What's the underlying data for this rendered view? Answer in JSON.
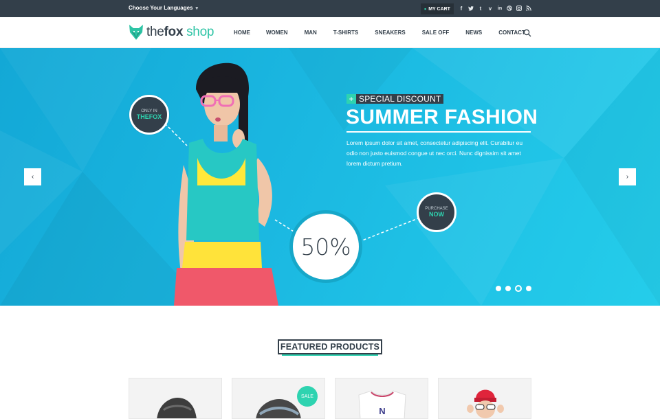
{
  "topbar": {
    "language_label": "Choose Your Languages",
    "cart_label": "MY CART",
    "social_icons": [
      "facebook-icon",
      "twitter-icon",
      "tumblr-icon",
      "vimeo-icon",
      "linkedin-icon",
      "dribbble-icon",
      "instagram-icon",
      "rss-icon"
    ]
  },
  "header": {
    "logo_the": "the",
    "logo_fox": "fox",
    "logo_shop": " shop",
    "nav": [
      "HOME",
      "WOMEN",
      "MAN",
      "T-SHIRTS",
      "SNEAKERS",
      "SALE OFF",
      "NEWS",
      "CONTACT"
    ]
  },
  "hero": {
    "badge_only_line1": "ONLY IN",
    "badge_only_line2": "THEFOX",
    "discount_plus": "+",
    "discount_label": "SPECIAL DISCOUNT",
    "title": "SUMMER FASHION",
    "body": "Lorem ipsum dolor sit amet, consectetur adipiscing elit. Curabitur eu odio non justo euismod congue ut nec orci. Nunc dignissim sit amet lorem dictum pretium.",
    "percent": "50%",
    "purchase_line1": "PURCHASE",
    "purchase_line2": "NOW",
    "slide_count": 4,
    "active_slide": 3,
    "prev_arrow": "‹",
    "next_arrow": "›"
  },
  "featured": {
    "title": "FEATURED PRODUCTS",
    "sale_badge": "SALE"
  },
  "colors": {
    "dark": "#333f4a",
    "accent": "#2ed3b0",
    "hero_blue": "#1ab6e0"
  }
}
